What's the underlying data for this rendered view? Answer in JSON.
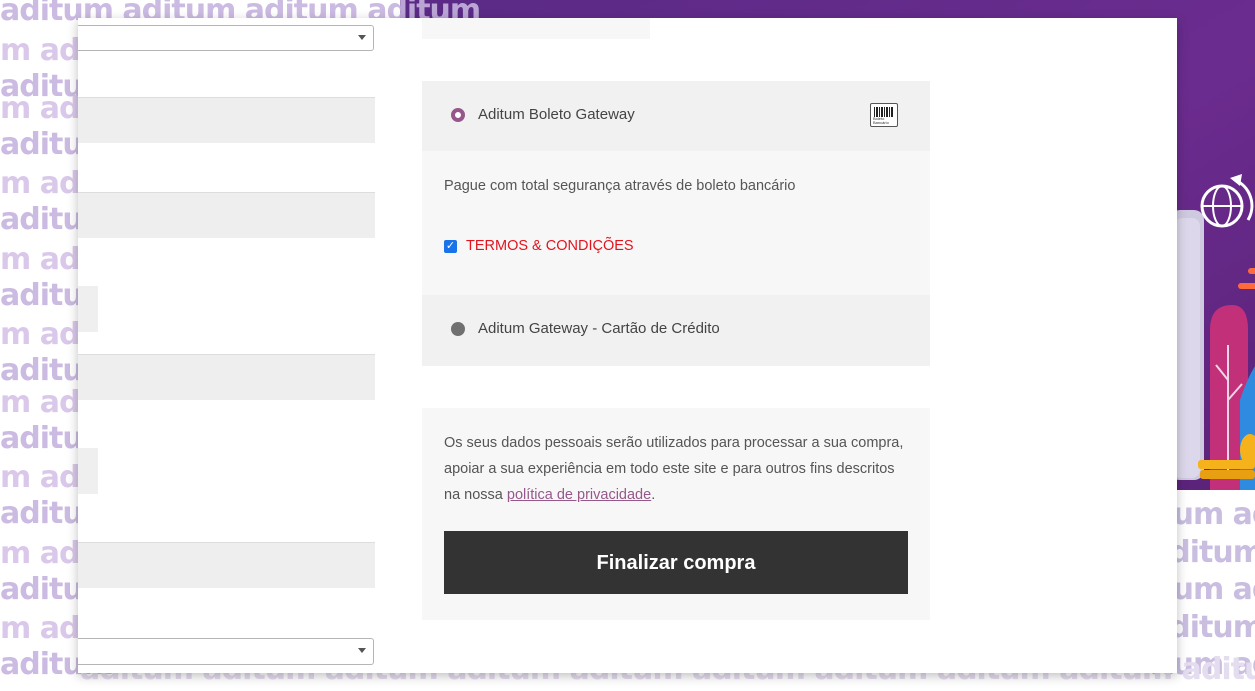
{
  "watermark": {
    "text": "aditum",
    "rows_left": [
      "aditum aditum aditum aditum",
      "m aditum",
      "aditum",
      "m aditum",
      "aditum",
      "m adi",
      "aditum",
      "m adi",
      "aditum",
      "m adi",
      "aditum",
      "m adi",
      "aditum",
      "m adi",
      "aditum",
      "m adi",
      "aditum",
      "m adi",
      "aditum"
    ],
    "rows_right": [
      "itum ad",
      "aditum",
      "itum ad",
      "aditum",
      "itum ad"
    ],
    "bottom": "aditum aditum aditum aditum aditum aditum aditum aditum aditum aditum"
  },
  "payment": {
    "selected_method": "boleto",
    "methods": [
      {
        "id": "boleto",
        "label": "Aditum Boleto Gateway",
        "icon": "barcode-icon",
        "icon_text": "Boleto Bancário",
        "description": "Pague com total segurança através de boleto bancário",
        "terms_label": "TERMOS & CONDIÇÕES",
        "terms_checked": true
      },
      {
        "id": "credit",
        "label": "Aditum Gateway - Cartão de Crédito"
      }
    ]
  },
  "privacy": {
    "text_before": "Os seus dados pessoais serão utilizados para processar a sua compra, apoiar a sua experiência em todo este site e para outros fins descritos na nossa ",
    "link": "política de privacidade",
    "text_after": "."
  },
  "submit_label": "Finalizar compra",
  "colors": {
    "brand_purple": "#5a2a86",
    "radio_selected": "#96588a",
    "terms_red": "#e3141e",
    "button": "#333333"
  }
}
